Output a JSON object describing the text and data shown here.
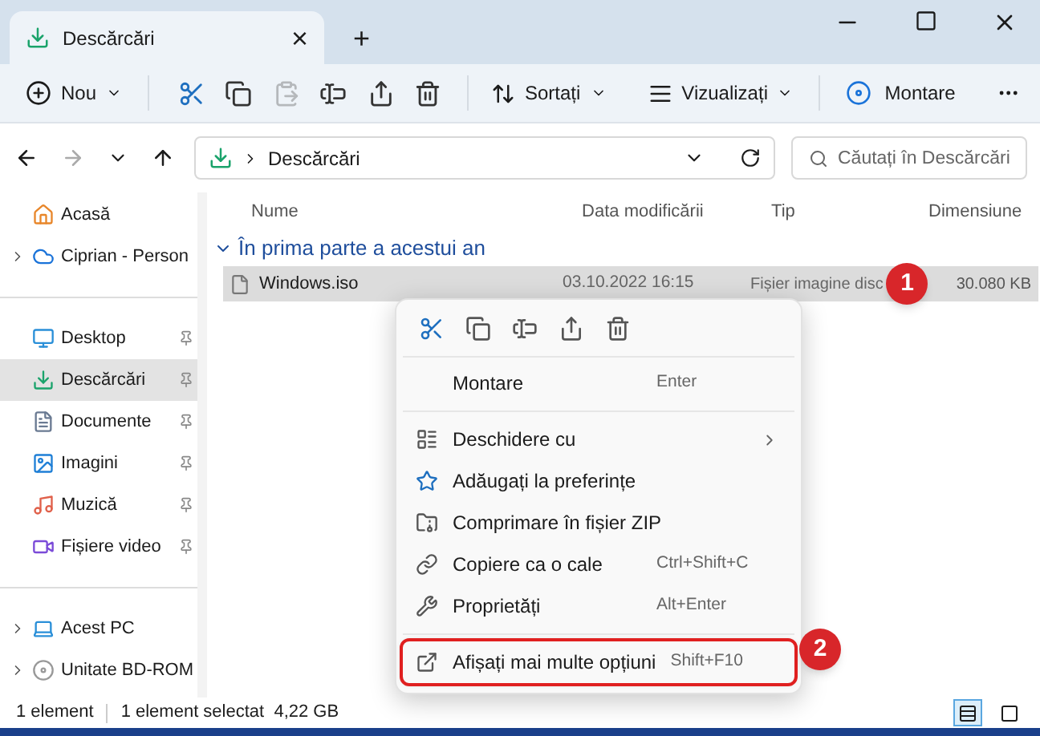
{
  "tab": {
    "title": "Descărcări",
    "close": "×",
    "new_tab": "+"
  },
  "toolbar": {
    "new_button": "Nou",
    "icon_buttons": [
      {
        "disabled": false
      },
      {
        "disabled": false
      },
      {
        "disabled": true
      },
      {
        "disabled": false
      },
      {
        "disabled": false
      },
      {
        "disabled": false
      }
    ],
    "sort_button": "Sortați",
    "view_button": "Vizualizați",
    "mount_button": "Montare"
  },
  "address": {
    "path": "Descărcări",
    "search_placeholder": "Căutați în Descărcări"
  },
  "sidebar": {
    "groups": [
      [
        {
          "label": "Acasă",
          "expandable": false,
          "pinned": false,
          "selected": false
        },
        {
          "label": "Ciprian - Person",
          "expandable": true,
          "pinned": false,
          "selected": false
        }
      ],
      [
        {
          "label": "Desktop",
          "expandable": false,
          "pinned": true,
          "selected": false
        },
        {
          "label": "Descărcări",
          "expandable": false,
          "pinned": true,
          "selected": true
        },
        {
          "label": "Documente",
          "expandable": false,
          "pinned": true,
          "selected": false
        },
        {
          "label": "Imagini",
          "expandable": false,
          "pinned": true,
          "selected": false
        },
        {
          "label": "Muzică",
          "expandable": false,
          "pinned": true,
          "selected": false
        },
        {
          "label": "Fișiere video",
          "expandable": false,
          "pinned": true,
          "selected": false
        }
      ],
      [
        {
          "label": "Acest PC",
          "expandable": true,
          "pinned": false,
          "selected": false
        },
        {
          "label": "Unitate BD-ROM",
          "expandable": true,
          "pinned": false,
          "selected": false
        }
      ]
    ]
  },
  "columns": [
    "Nume",
    "Data modificării",
    "Tip",
    "Dimensiune"
  ],
  "group": {
    "title": "În prima parte a acestui an",
    "expanded": true
  },
  "files": [
    {
      "name": "Windows.iso",
      "date": "03.10.2022 16:15",
      "type": "Fișier imagine disc",
      "size": "30.080 KB",
      "selected": true
    }
  ],
  "context_menu": {
    "items": [
      {
        "label": "Montare",
        "shortcut": "Enter",
        "submenu": false,
        "highlighted": false
      },
      {
        "label": "Deschidere cu",
        "submenu": true,
        "highlighted": false
      },
      {
        "label": "Adăugați la preferințe",
        "submenu": false,
        "highlighted": false
      },
      {
        "label": "Comprimare în fișier ZIP",
        "submenu": false,
        "highlighted": false
      },
      {
        "label": "Copiere ca o cale",
        "shortcut": "Ctrl+Shift+C",
        "submenu": false,
        "highlighted": false
      },
      {
        "label": "Proprietăți",
        "shortcut": "Alt+Enter",
        "submenu": false,
        "highlighted": false
      },
      {
        "label": "Afișați mai multe opțiuni",
        "shortcut": "Shift+F10",
        "submenu": false,
        "highlighted": true
      }
    ]
  },
  "annotations": [
    "1",
    "2"
  ],
  "status_bar": {
    "count": "1 element",
    "selection": "1 element selectat  4,22 GB",
    "views": [
      {
        "selected": true
      },
      {
        "selected": false
      }
    ]
  }
}
